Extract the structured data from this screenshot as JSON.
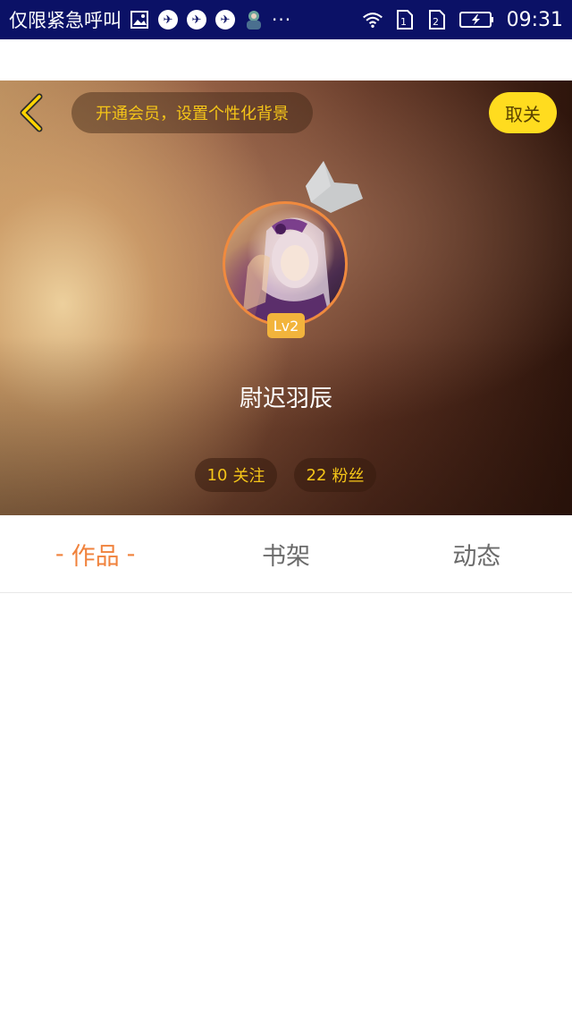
{
  "status_bar": {
    "carrier": "仅限紧急呼叫",
    "time": "09:31",
    "icons": [
      "image-icon",
      "app-notification-icon",
      "app-notification-icon",
      "app-notification-icon",
      "avatar-notification-icon",
      "more-dots-icon",
      "wifi-icon",
      "sim1-icon",
      "sim2-icon",
      "battery-charging-icon"
    ],
    "more": "···"
  },
  "header": {
    "back_icon": "chevron-left-icon",
    "vip_promo": "开通会员，设置个性化背景",
    "cancel_follow": "取关"
  },
  "profile": {
    "crown_icon": "crown-icon",
    "level": "Lv2",
    "username": "尉迟羽辰",
    "follow_count": "10",
    "follow_label": "关注",
    "fans_count": "22",
    "fans_label": "粉丝"
  },
  "tabs": [
    {
      "label": "作品",
      "active": true,
      "dash": "-"
    },
    {
      "label": "书架",
      "active": false
    },
    {
      "label": "动态",
      "active": false
    }
  ],
  "colors": {
    "status_bar": "#0b1166",
    "accent_orange": "#f0823c",
    "accent_yellow": "#ffdc1f",
    "promo_text": "#f5c518"
  }
}
